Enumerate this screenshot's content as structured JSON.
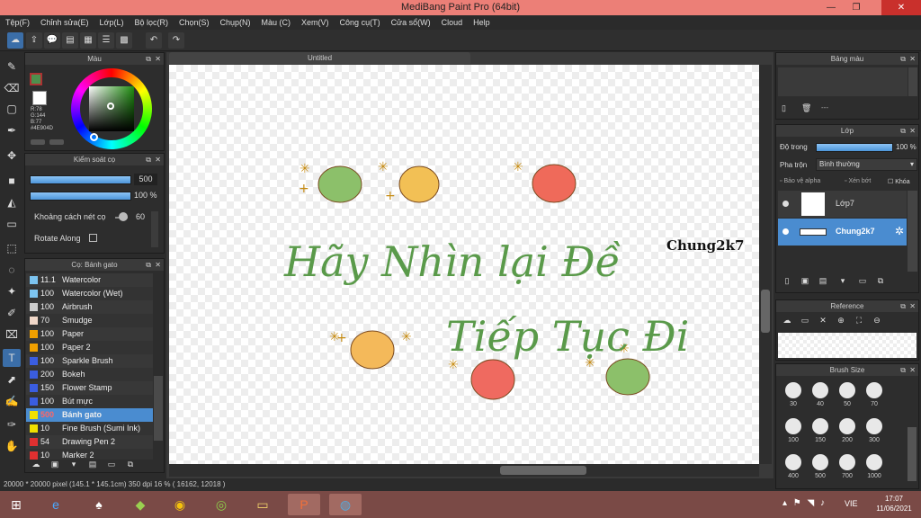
{
  "window": {
    "title": "MediBang Paint Pro (64bit)"
  },
  "menu": [
    "Tệp(F)",
    "Chỉnh sửa(E)",
    "Lớp(L)",
    "Bộ lọc(R)",
    "Chọn(S)",
    "Chụp(N)",
    "Màu (C)",
    "Xem(V)",
    "Công cụ(T)",
    "Cửa sổ(W)",
    "Cloud",
    "Help"
  ],
  "color_panel": {
    "title": "Màu",
    "r": "R:78",
    "g": "G:144",
    "b": "B:77",
    "hex": "#4E904D",
    "fg": "#4e904d"
  },
  "brush_control": {
    "title": "Kiểm soát cọ",
    "size": "500",
    "opacity": "100 %",
    "spacing_label": "Khoảng cách nét cọ",
    "spacing": "60",
    "rotate_label": "Rotate Along"
  },
  "brush_list": {
    "title": "Cọ: Bánh gato",
    "items": [
      {
        "size": "11.1",
        "name": "Watercolor",
        "color": "#7cc4f0"
      },
      {
        "size": "100",
        "name": "Watercolor (Wet)",
        "color": "#7cc4f0"
      },
      {
        "size": "100",
        "name": "Airbrush",
        "color": "#cccccc"
      },
      {
        "size": "70",
        "name": "Smudge",
        "color": "#f0d7c8"
      },
      {
        "size": "100",
        "name": "Paper",
        "color": "#f0a000"
      },
      {
        "size": "100",
        "name": "Paper 2",
        "color": "#f0a000"
      },
      {
        "size": "100",
        "name": "Sparkle Brush",
        "color": "#3a5de0"
      },
      {
        "size": "200",
        "name": "Bokeh",
        "color": "#3a5de0"
      },
      {
        "size": "150",
        "name": "Flower Stamp",
        "color": "#3a5de0"
      },
      {
        "size": "100",
        "name": "Bút mực",
        "color": "#3a5de0"
      },
      {
        "size": "500",
        "name": "Bánh gato",
        "color": "#f0e000",
        "selected": true
      },
      {
        "size": "10",
        "name": "Fine Brush (Sumi Ink)",
        "color": "#f0e000"
      },
      {
        "size": "54",
        "name": "Drawing Pen 2",
        "color": "#e03030"
      },
      {
        "size": "10",
        "name": "Marker 2",
        "color": "#e03030"
      }
    ]
  },
  "document": {
    "tab": "Untitled",
    "artwork_line1": "Hãy Nhìn lại Đề",
    "artwork_line2": "Tiếp Tục Đi",
    "signature": "Chung2k7"
  },
  "palette_panel": {
    "title": "Bảng màu",
    "empty": "---"
  },
  "layer_panel": {
    "title": "Lớp",
    "opacity_label": "Độ trong",
    "opacity": "100 %",
    "blend_label": "Pha trộn",
    "blend": "Bình thường",
    "protect_alpha": "Bảo vệ alpha",
    "clip": "Xén bớt",
    "lock": "Khóa",
    "layers": [
      {
        "name": "Lớp7",
        "selected": false
      },
      {
        "name": "Chung2k7",
        "selected": true
      }
    ]
  },
  "reference_panel": {
    "title": "Reference"
  },
  "brush_size_panel": {
    "title": "Brush Size",
    "sizes": [
      "30",
      "40",
      "50",
      "70",
      "100",
      "150",
      "200",
      "300",
      "400",
      "500",
      "700",
      "1000"
    ]
  },
  "statusbar": {
    "dims": "20000 * 20000 pixel",
    "cm": "(145.1 * 145.1cm)",
    "dpi": "350 dpi",
    "zoom": "16 %",
    "coords": "( 16162, 12018 )"
  },
  "taskbar": {
    "lang": "VIE",
    "time": "17:07",
    "date": "11/06/2021"
  }
}
